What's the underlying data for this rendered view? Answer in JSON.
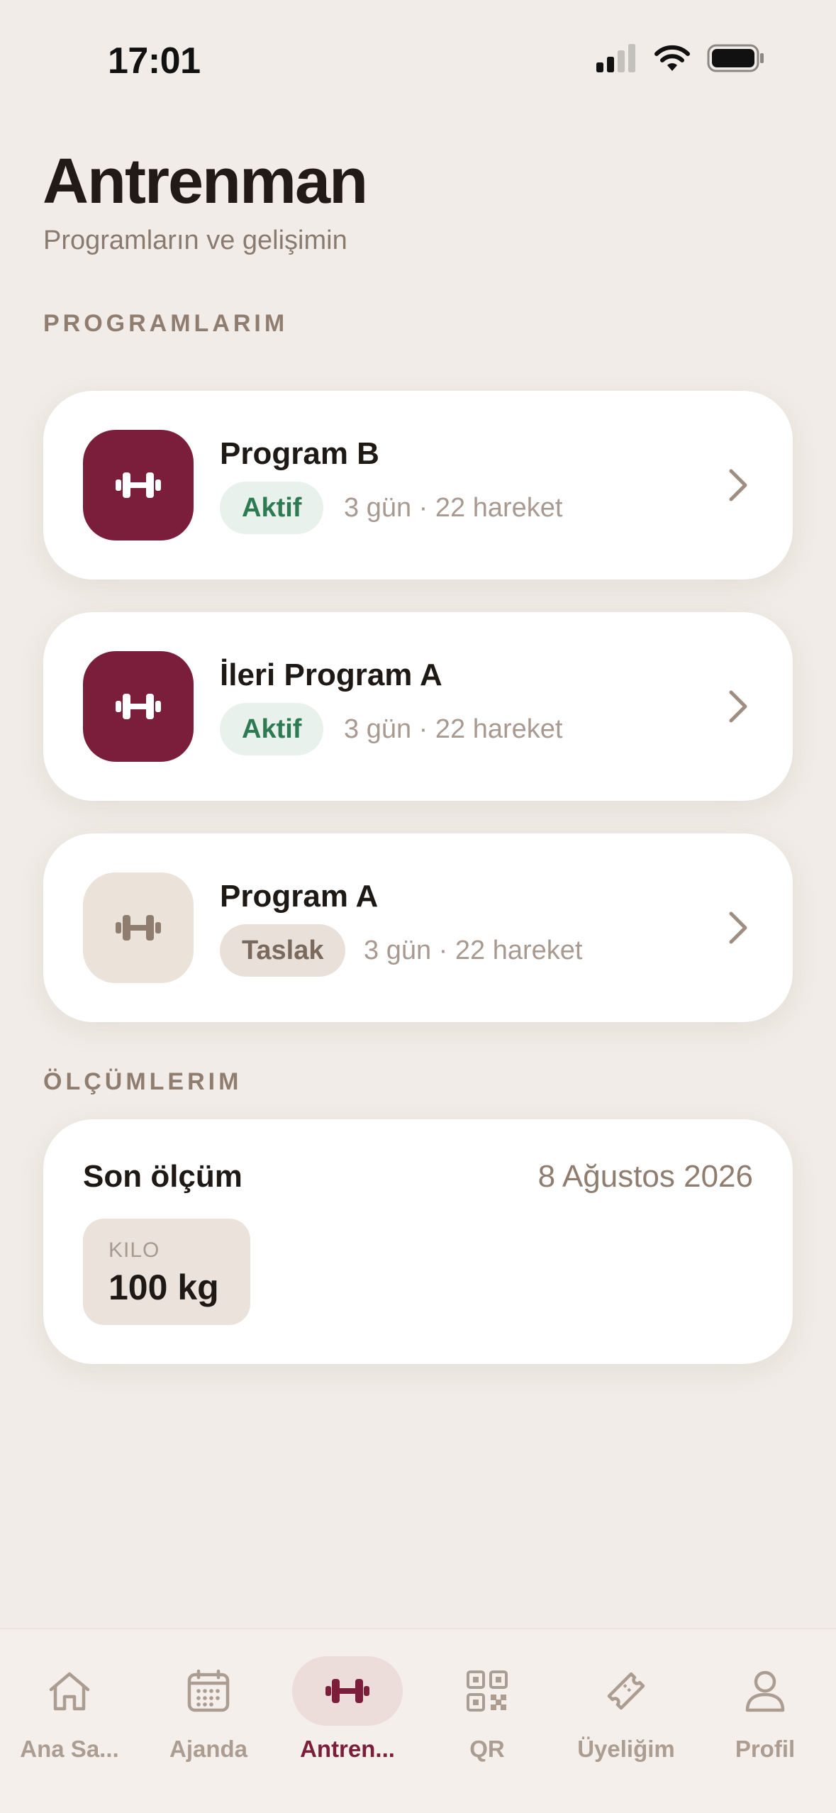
{
  "status_bar": {
    "time": "17:01"
  },
  "header": {
    "title": "Antrenman",
    "subtitle": "Programların ve gelişimin"
  },
  "sections": {
    "programs_label": "PROGRAMLARIM",
    "measurements_label": "ÖLÇÜMLERIM"
  },
  "programs": [
    {
      "name": "Program B",
      "status": "Aktif",
      "meta": "3 gün · 22 hareket",
      "icon": "dumbbell-icon"
    },
    {
      "name": "İleri Program A",
      "status": "Aktif",
      "meta": "3 gün · 22 hareket",
      "icon": "dumbbell-icon"
    },
    {
      "name": "Program A",
      "status": "Taslak",
      "meta": "3 gün · 22 hareket",
      "icon": "dumbbell-icon"
    }
  ],
  "measurement": {
    "title": "Son ölçüm",
    "date": "8 Ağustos 2026",
    "metric_label": "KILO",
    "metric_value": "100 kg"
  },
  "tabs": [
    {
      "label": "Ana Sa...",
      "icon": "home-icon"
    },
    {
      "label": "Ajanda",
      "icon": "calendar-icon"
    },
    {
      "label": "Antren...",
      "icon": "dumbbell-icon",
      "active": true
    },
    {
      "label": "QR",
      "icon": "qr-code-icon"
    },
    {
      "label": "Üyeliğim",
      "icon": "ticket-icon"
    },
    {
      "label": "Profil",
      "icon": "person-icon"
    }
  ],
  "colors": {
    "background": "#f1ece7",
    "accent": "#7b1e3b",
    "active_badge_text": "#2e7a53",
    "active_badge_bg": "#e8f1ec",
    "draft_badge_bg": "#e9e1d9"
  }
}
